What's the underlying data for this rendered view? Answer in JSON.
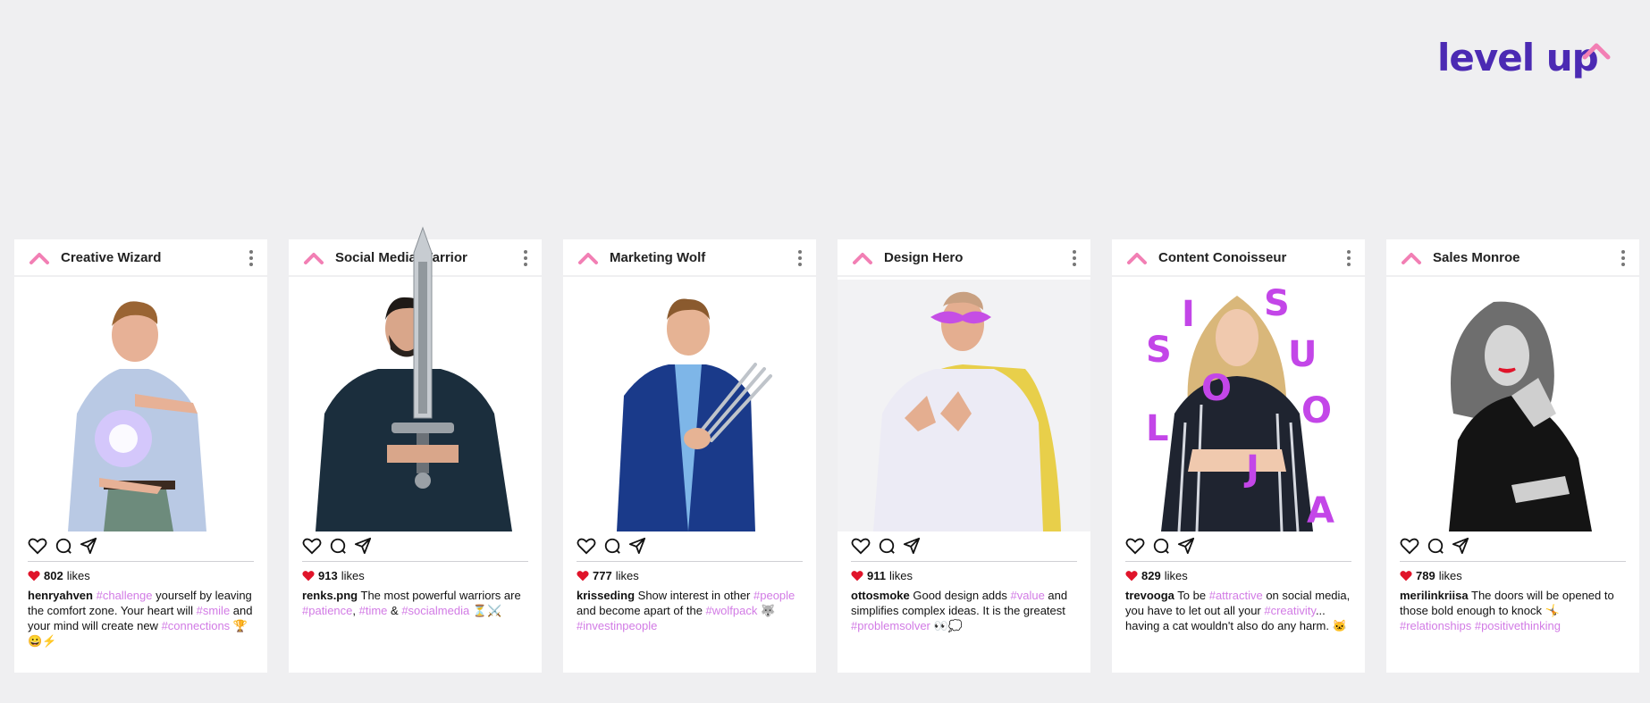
{
  "brand": {
    "logo_text": "level up",
    "accent": "#f27fb4",
    "logo_color": "#4b2ab3",
    "hashtag_color": "#d27be5"
  },
  "likes_suffix": "likes",
  "cards": [
    {
      "title": "Creative Wizard",
      "likes": "802",
      "username": "henryahven",
      "caption": [
        {
          "text": "#challenge",
          "tag": true
        },
        {
          "text": " yourself by leaving the comfort zone. Your heart will ",
          "tag": false
        },
        {
          "text": "#smile",
          "tag": true
        },
        {
          "text": " and your mind will create new ",
          "tag": false
        },
        {
          "text": "#connections",
          "tag": true
        },
        {
          "text": " 🏆😀⚡",
          "tag": false
        }
      ]
    },
    {
      "title": "Social Media Warrior",
      "likes": "913",
      "username": "renks.png",
      "caption": [
        {
          "text": "The most powerful warriors are ",
          "tag": false
        },
        {
          "text": "#patience",
          "tag": true
        },
        {
          "text": ", ",
          "tag": false
        },
        {
          "text": "#time",
          "tag": true
        },
        {
          "text": " & ",
          "tag": false
        },
        {
          "text": "#socialmedia",
          "tag": true
        },
        {
          "text": " ⏳⚔️",
          "tag": false
        }
      ]
    },
    {
      "title": "Marketing Wolf",
      "likes": "777",
      "username": "krisseding",
      "caption": [
        {
          "text": "Show interest in other ",
          "tag": false
        },
        {
          "text": "#people",
          "tag": true
        },
        {
          "text": " and become apart of the ",
          "tag": false
        },
        {
          "text": "#wolfpack",
          "tag": true
        },
        {
          "text": " 🐺 ",
          "tag": false
        },
        {
          "text": "#investinpeople",
          "tag": true
        }
      ]
    },
    {
      "title": "Design Hero",
      "likes": "911",
      "username": "ottosmoke",
      "caption": [
        {
          "text": "Good design adds ",
          "tag": false
        },
        {
          "text": "#value",
          "tag": true
        },
        {
          "text": " and simplifies complex ideas. It is the greatest ",
          "tag": false
        },
        {
          "text": "#problemsolver",
          "tag": true
        },
        {
          "text": " 👀💭",
          "tag": false
        }
      ]
    },
    {
      "title": "Content Conoisseur",
      "likes": "829",
      "username": "trevooga",
      "caption": [
        {
          "text": "To be ",
          "tag": false
        },
        {
          "text": "#attractive",
          "tag": true
        },
        {
          "text": " on social media, you have to let out all your ",
          "tag": false
        },
        {
          "text": "#creativity",
          "tag": true
        },
        {
          "text": "... having a cat wouldn't also do any harm. 🐱",
          "tag": false
        }
      ],
      "overlay_letters": [
        "S",
        "I",
        "S",
        "U",
        "O",
        "L",
        "O",
        "J",
        "A"
      ]
    },
    {
      "title": "Sales Monroe",
      "likes": "789",
      "username": "merilinkriisa",
      "caption": [
        {
          "text": "The doors will be opened to those bold enough to knock 🤸 ",
          "tag": false
        },
        {
          "text": "#relationships",
          "tag": true
        },
        {
          "text": " ",
          "tag": false
        },
        {
          "text": "#positivethinking",
          "tag": true
        }
      ]
    }
  ],
  "icons": [
    "chevron-up-icon",
    "more-vertical-icon",
    "heart-icon",
    "comment-icon",
    "send-icon",
    "heart-filled-icon"
  ]
}
